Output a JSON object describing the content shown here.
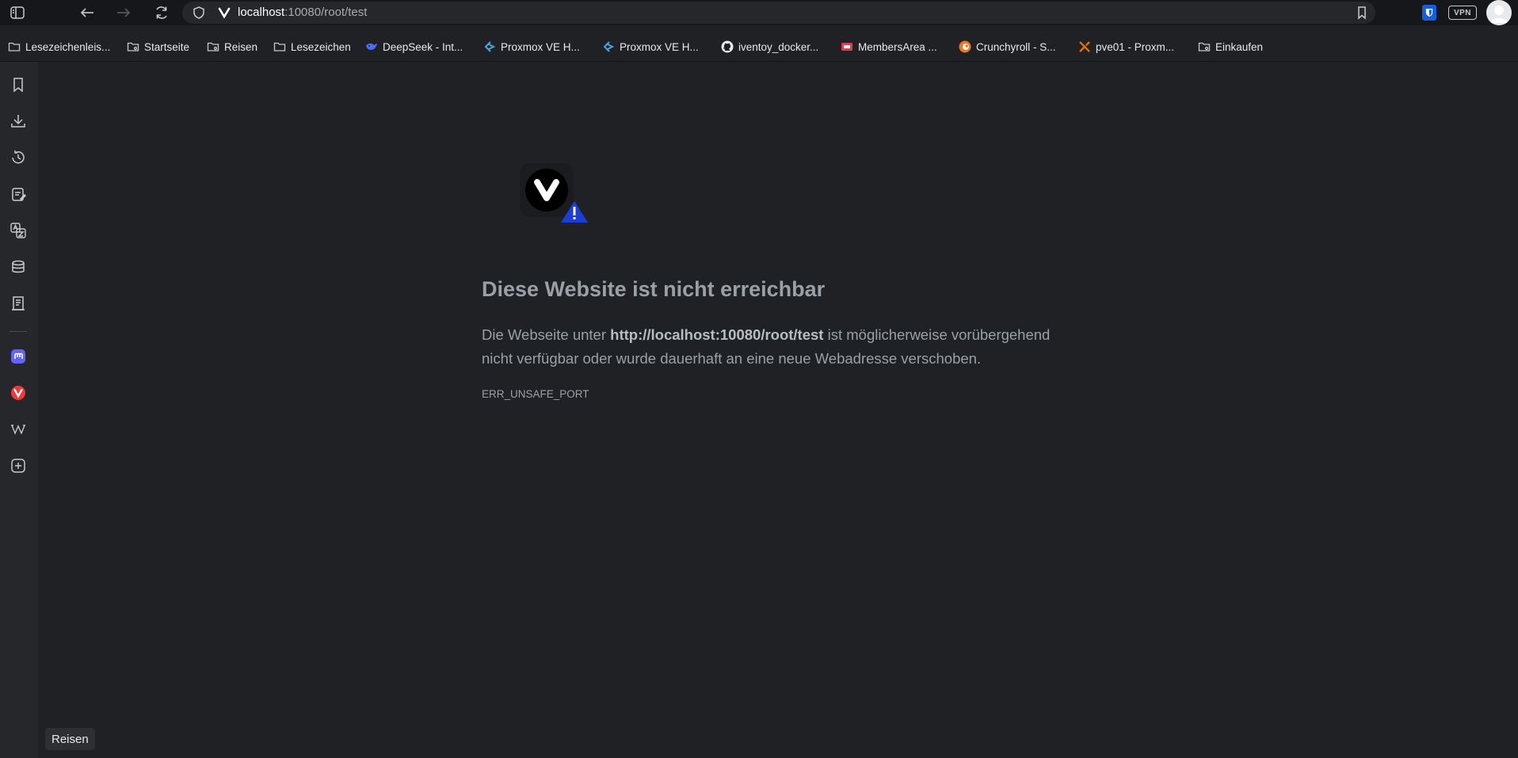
{
  "address_bar": {
    "host": "localhost",
    "rest": ":10080/root/test"
  },
  "extensions": {
    "vpn_label": "VPN"
  },
  "bookmarks": [
    {
      "label": "Lesezeichenleis...",
      "icon": "folder-icon"
    },
    {
      "label": "Startseite",
      "icon": "folder-shared-icon"
    },
    {
      "label": "Reisen",
      "icon": "folder-shared-icon"
    },
    {
      "label": "Lesezeichen",
      "icon": "folder-icon"
    },
    {
      "label": "DeepSeek - Int...",
      "icon": "deepseek-icon"
    },
    {
      "label": "Proxmox VE H...",
      "icon": "proxmox-icon"
    },
    {
      "label": "Proxmox VE H...",
      "icon": "proxmox-icon"
    },
    {
      "label": "iventoy_docker...",
      "icon": "github-icon"
    },
    {
      "label": "MembersArea ...",
      "icon": "membersarea-icon"
    },
    {
      "label": "Crunchyroll - S...",
      "icon": "crunchyroll-icon"
    },
    {
      "label": "pve01 - Proxm...",
      "icon": "proxmox-x-icon"
    },
    {
      "label": "Einkaufen",
      "icon": "folder-shared-icon"
    }
  ],
  "sidebar": {
    "items": [
      "bookmarks-icon",
      "downloads-icon",
      "history-icon",
      "notes-icon",
      "translate-icon",
      "reading-list-icon",
      "window-panel-icon",
      "mastodon-icon",
      "vivaldi-icon",
      "wikipedia-icon",
      "add-panel-icon"
    ]
  },
  "error": {
    "title": "Diese Website ist nicht erreichbar",
    "desc_prefix": "Die Webseite unter ",
    "desc_url": "http://localhost:10080/root/test",
    "desc_suffix": " ist möglicherweise vorübergehend nicht verfügbar oder wurde dauerhaft an eine neue Webadresse verschoben.",
    "code": "ERR_UNSAFE_PORT"
  },
  "status": {
    "hover_text": "Reisen"
  },
  "colors": {
    "page_bg": "#202125",
    "toolbar_bg": "#16171a",
    "sidebar_bg": "#26272b",
    "error_text": "#9aa0a6",
    "warning_blue": "#1a3fd8",
    "bitwarden_blue": "#175ddc"
  }
}
